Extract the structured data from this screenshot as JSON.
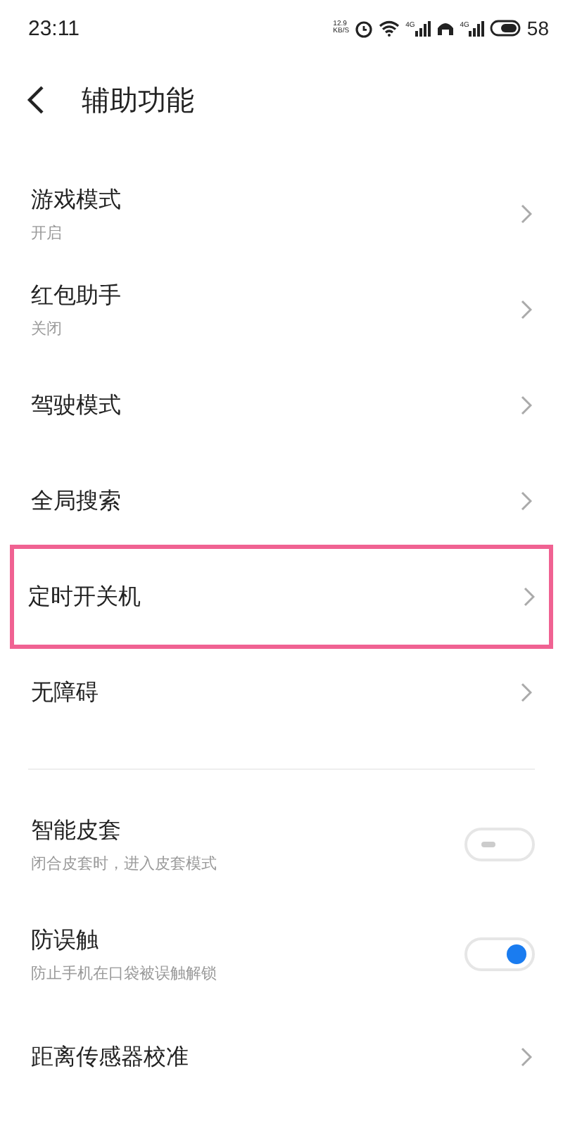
{
  "status_bar": {
    "time": "23:11",
    "speed_value": "12.9",
    "speed_unit": "KB/S",
    "network_1": "4G",
    "network_2": "4G",
    "battery": "58"
  },
  "header": {
    "title": "辅助功能"
  },
  "sections": [
    {
      "items": [
        {
          "kind": "nav",
          "title": "游戏模式",
          "subtitle": "开启",
          "highlighted": false
        },
        {
          "kind": "nav",
          "title": "红包助手",
          "subtitle": "关闭",
          "highlighted": false
        },
        {
          "kind": "nav",
          "title": "驾驶模式",
          "highlighted": false
        },
        {
          "kind": "nav",
          "title": "全局搜索",
          "highlighted": false
        },
        {
          "kind": "nav",
          "title": "定时开关机",
          "highlighted": true
        },
        {
          "kind": "nav",
          "title": "无障碍",
          "highlighted": false
        }
      ]
    },
    {
      "items": [
        {
          "kind": "toggle",
          "title": "智能皮套",
          "subtitle": "闭合皮套时，进入皮套模式",
          "on": false
        },
        {
          "kind": "toggle",
          "title": "防误触",
          "subtitle": "防止手机在口袋被误触解锁",
          "on": true
        },
        {
          "kind": "nav",
          "title": "距离传感器校准",
          "highlighted": false
        }
      ]
    }
  ]
}
